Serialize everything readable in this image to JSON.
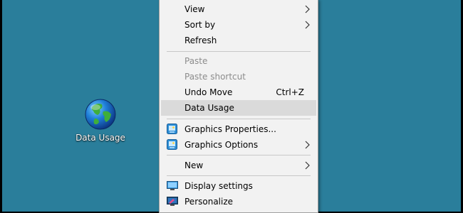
{
  "desktop": {
    "background": "#2a7e9b",
    "icon": {
      "label": "Data Usage",
      "icon": "globe-icon"
    }
  },
  "context_menu": {
    "items": [
      {
        "label": "View",
        "submenu": true
      },
      {
        "label": "Sort by",
        "submenu": true
      },
      {
        "label": "Refresh"
      },
      {
        "label": "Paste",
        "disabled": true
      },
      {
        "label": "Paste shortcut",
        "disabled": true
      },
      {
        "label": "Undo Move",
        "shortcut": "Ctrl+Z"
      },
      {
        "label": "Data Usage",
        "highlighted": true
      },
      {
        "label": "Graphics Properties...",
        "icon": "graphics-icon"
      },
      {
        "label": "Graphics Options",
        "icon": "graphics-icon",
        "submenu": true
      },
      {
        "label": "New",
        "submenu": true
      },
      {
        "label": "Display settings",
        "icon": "display-icon"
      },
      {
        "label": "Personalize",
        "icon": "personalize-icon"
      }
    ]
  }
}
